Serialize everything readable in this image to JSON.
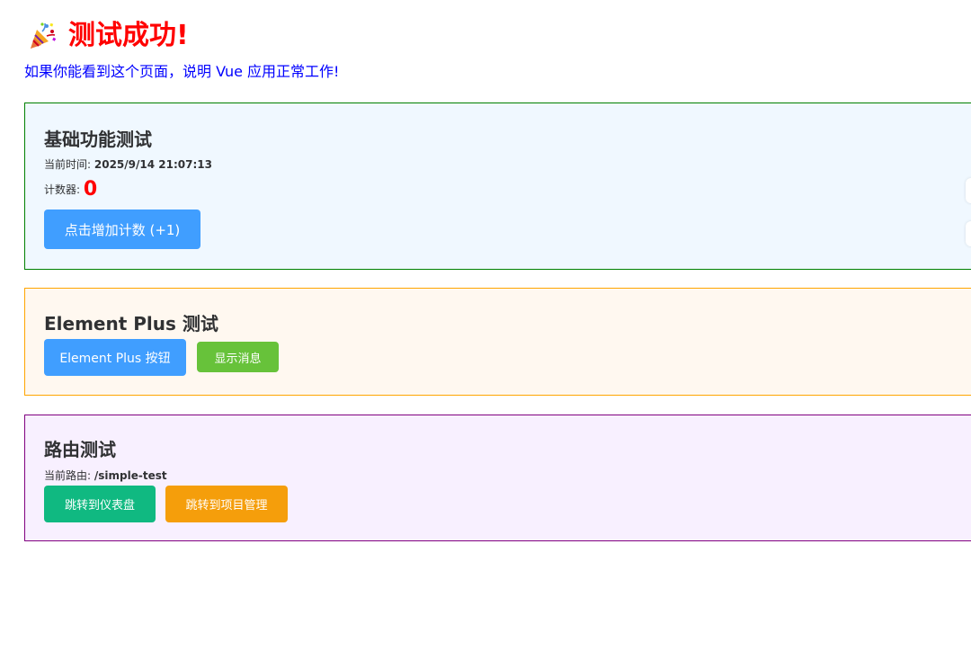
{
  "header": {
    "icon": "party-popper-icon",
    "title": "测试成功!",
    "subtitle": "如果你能看到这个页面，说明 Vue 应用正常工作!"
  },
  "basic_card": {
    "title": "基础功能测试",
    "time_label": "当前时间:",
    "time_value": "2025/9/14 21:07:13",
    "counter_label": "计数器:",
    "counter_value": "0",
    "increment_button": "点击增加计数 (+1)"
  },
  "element_card": {
    "title": "Element Plus 测试",
    "primary_button": "Element Plus 按钮",
    "message_button": "显示消息"
  },
  "router_card": {
    "title": "路由测试",
    "route_label": "当前路由:",
    "route_value": "/simple-test",
    "dashboard_button": "跳转到仪表盘",
    "projects_button": "跳转到项目管理"
  },
  "colors": {
    "title": "#ff0000",
    "subtitle": "#0000ff",
    "basic_border": "#008000",
    "element_border": "#ffa500",
    "router_border": "#800080",
    "primary": "#409eff",
    "success": "#67c23a",
    "emerald": "#10b981",
    "amber": "#f59e0b"
  }
}
